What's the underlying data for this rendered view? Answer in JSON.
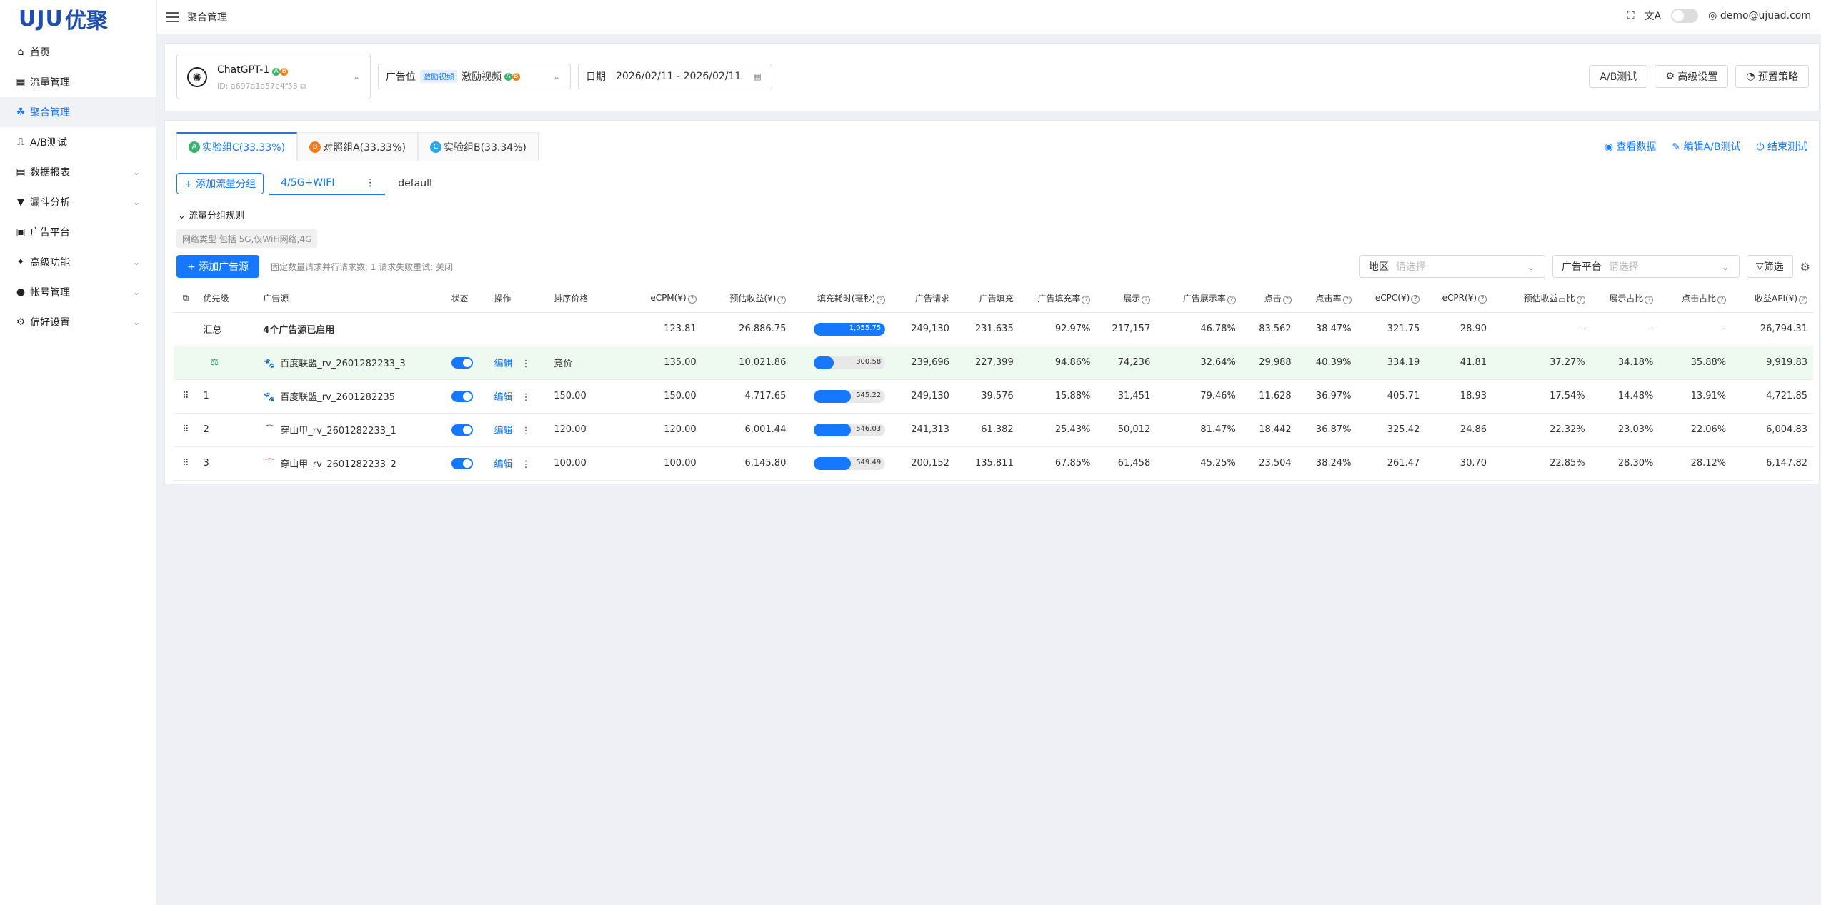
{
  "brand": {
    "logo_mark": "UJU",
    "logo_text": "优聚"
  },
  "sidebar": {
    "items": [
      {
        "label": "首页",
        "icon": "home-icon",
        "active": false,
        "expandable": false
      },
      {
        "label": "流量管理",
        "icon": "grid-icon",
        "active": false,
        "expandable": false
      },
      {
        "label": "聚合管理",
        "icon": "cluster-icon",
        "active": true,
        "expandable": false
      },
      {
        "label": "A/B测试",
        "icon": "ab-icon",
        "active": false,
        "expandable": false
      },
      {
        "label": "数据报表",
        "icon": "report-icon",
        "active": false,
        "expandable": true
      },
      {
        "label": "漏斗分析",
        "icon": "funnel-icon",
        "active": false,
        "expandable": true
      },
      {
        "label": "广告平台",
        "icon": "platform-icon",
        "active": false,
        "expandable": false
      },
      {
        "label": "高级功能",
        "icon": "sparkle-icon",
        "active": false,
        "expandable": true
      },
      {
        "label": "帐号管理",
        "icon": "user-icon",
        "active": false,
        "expandable": true
      },
      {
        "label": "偏好设置",
        "icon": "gear-icon",
        "active": false,
        "expandable": true
      }
    ]
  },
  "topbar": {
    "breadcrumb": "聚合管理",
    "user": "demo@ujuad.com"
  },
  "filters": {
    "app_name": "ChatGPT-1",
    "app_id": "ID: a697a1a57e4f53",
    "adpos_label": "广告位",
    "adpos_tag": "激励视频",
    "adpos_value": "激励视频",
    "date_label": "日期",
    "date_value": "2026/02/11 - 2026/02/11",
    "btn_ab": "A/B测试",
    "btn_adv": "高级设置",
    "btn_preset": "预置策略"
  },
  "experiment": {
    "tabs": [
      {
        "badge": "A",
        "label": "实验组C(33.33%)",
        "color": "#3cb371",
        "active": true
      },
      {
        "badge": "B",
        "label": "对照组A(33.33%)",
        "color": "#f07c1a",
        "active": false
      },
      {
        "badge": "C",
        "label": "实验组B(33.34%)",
        "color": "#2aa7e6",
        "active": false
      }
    ],
    "actions": {
      "view": "查看数据",
      "edit": "编辑A/B测试",
      "end": "结束测试"
    }
  },
  "groups": {
    "add_label": "+ 添加流量分组",
    "tabs": [
      "4/5G+WIFI",
      "default"
    ]
  },
  "rules": {
    "title": "流量分组规则",
    "tag": "网络类型 包括 5G,仅WiFi网络,4G"
  },
  "sources_toolbar": {
    "add_label": "+ 添加广告源",
    "hint": "固定数量请求并行请求数: 1 请求失败重试: 关闭",
    "region_label": "地区",
    "region_placeholder": "请选择",
    "platform_label": "广告平台",
    "platform_placeholder": "请选择",
    "filter_label": "筛选"
  },
  "table": {
    "columns": [
      "优先级",
      "广告源",
      "状态",
      "操作",
      "排序价格",
      "eCPM(¥)",
      "预估收益(¥)",
      "填充耗时(毫秒)",
      "广告请求",
      "广告填充",
      "广告填充率",
      "展示",
      "广告展示率",
      "点击",
      "点击率",
      "eCPC(¥)",
      "eCPR(¥)",
      "预估收益占比",
      "展示占比",
      "点击占比",
      "收益API(¥)"
    ],
    "summary": {
      "label": "汇总",
      "source": "4个广告源已启用",
      "ecpm": "123.81",
      "revenue": "26,886.75",
      "fill_ms": "1,055.75",
      "fill_pct": 1.0,
      "requests": "249,130",
      "fills": "231,635",
      "fill_rate": "92.97%",
      "impressions": "217,157",
      "show_rate": "46.78%",
      "clicks": "83,562",
      "ctr": "38.47%",
      "ecpc": "321.75",
      "ecpr": "28.90",
      "rev_share": "-",
      "imp_share": "-",
      "click_share": "-",
      "api_rev": "26,794.31"
    },
    "rows": [
      {
        "priority": "",
        "source": "百度联盟_rv_2601282233_3",
        "icon": "paw-icon",
        "icon_color": "#1677ff",
        "edit": "编辑",
        "price": "竞价",
        "ecpm": "135.00",
        "revenue": "10,021.86",
        "fill_ms": "300.58",
        "fill_pct": 0.28,
        "requests": "239,696",
        "fills": "227,399",
        "fill_rate": "94.86%",
        "impressions": "74,236",
        "show_rate": "32.64%",
        "clicks": "29,988",
        "ctr": "40.39%",
        "ecpc": "334.19",
        "ecpr": "41.81",
        "rev_share": "37.27%",
        "imp_share": "34.18%",
        "click_share": "35.88%",
        "api_rev": "9,919.83",
        "highlight": true
      },
      {
        "priority": "1",
        "source": "百度联盟_rv_2601282235",
        "icon": "paw-icon",
        "icon_color": "#1677ff",
        "edit": "编辑",
        "price": "150.00",
        "ecpm": "150.00",
        "revenue": "4,717.65",
        "fill_ms": "545.22",
        "fill_pct": 0.52,
        "requests": "249,130",
        "fills": "39,576",
        "fill_rate": "15.88%",
        "impressions": "31,451",
        "show_rate": "79.46%",
        "clicks": "11,628",
        "ctr": "36.97%",
        "ecpc": "405.71",
        "ecpr": "18.93",
        "rev_share": "17.54%",
        "imp_share": "14.48%",
        "click_share": "13.91%",
        "api_rev": "4,721.85",
        "highlight": false
      },
      {
        "priority": "2",
        "source": "穿山甲_rv_2601282233_1",
        "icon": "pangle-icon",
        "icon_color": "#e53935",
        "edit": "编辑",
        "price": "120.00",
        "ecpm": "120.00",
        "revenue": "6,001.44",
        "fill_ms": "546.03",
        "fill_pct": 0.52,
        "requests": "241,313",
        "fills": "61,382",
        "fill_rate": "25.43%",
        "impressions": "50,012",
        "show_rate": "81.47%",
        "clicks": "18,442",
        "ctr": "36.87%",
        "ecpc": "325.42",
        "ecpr": "24.86",
        "rev_share": "22.32%",
        "imp_share": "23.03%",
        "click_share": "22.06%",
        "api_rev": "6,004.83",
        "highlight": false
      },
      {
        "priority": "3",
        "source": "穿山甲_rv_2601282233_2",
        "icon": "pangle-icon",
        "icon_color": "#e53935",
        "edit": "编辑",
        "price": "100.00",
        "ecpm": "100.00",
        "revenue": "6,145.80",
        "fill_ms": "549.49",
        "fill_pct": 0.52,
        "requests": "200,152",
        "fills": "135,811",
        "fill_rate": "67.85%",
        "impressions": "61,458",
        "show_rate": "45.25%",
        "clicks": "23,504",
        "ctr": "38.24%",
        "ecpc": "261.47",
        "ecpr": "30.70",
        "rev_share": "22.85%",
        "imp_share": "28.30%",
        "click_share": "28.12%",
        "api_rev": "6,147.82",
        "highlight": false
      }
    ]
  }
}
